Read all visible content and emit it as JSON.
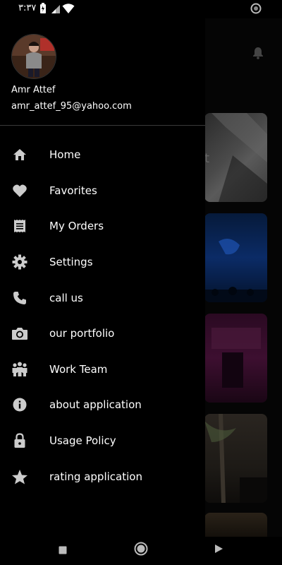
{
  "status_bar": {
    "time": "٣:٣٧"
  },
  "user": {
    "name": "Amr Attef",
    "email": "amr_attef_95@yahoo.com"
  },
  "menu": [
    {
      "label": "Home",
      "icon": "home-icon"
    },
    {
      "label": "Favorites",
      "icon": "heart-icon"
    },
    {
      "label": "My Orders",
      "icon": "receipt-icon"
    },
    {
      "label": "Settings",
      "icon": "gear-icon"
    },
    {
      "label": "call us",
      "icon": "phone-icon"
    },
    {
      "label": "our portfolio",
      "icon": "camera-icon"
    },
    {
      "label": "Work Team",
      "icon": "team-icon"
    },
    {
      "label": "about application",
      "icon": "info-icon"
    },
    {
      "label": "Usage Policy",
      "icon": "lock-icon"
    },
    {
      "label": "rating application",
      "icon": "star-icon"
    }
  ],
  "colors": {
    "background": "#000000",
    "icon": "#cccccc",
    "text": "#ffffff",
    "divider": "#3a3a3a"
  }
}
